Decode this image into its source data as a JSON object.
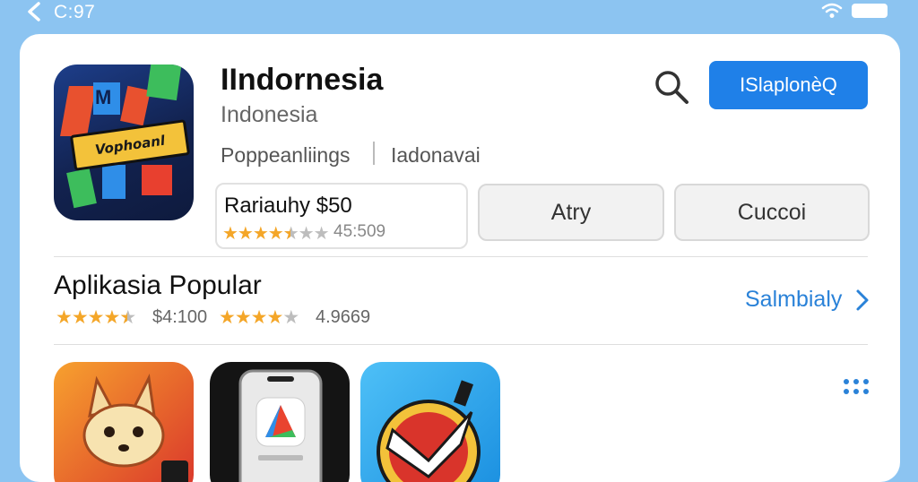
{
  "status_bar": {
    "time": "C:97"
  },
  "app": {
    "name": "IIndornesia",
    "subtitle": "Indonesia",
    "meta_left": "Poppeanliings",
    "meta_right": "Iadonavai",
    "icon_text": "Vophoanl",
    "icon_letters": "M",
    "primary_button": "ISlaplonѐQ",
    "price_label": "Rariauhy $50",
    "price_stars": 3.5,
    "price_rating": "45:509",
    "button_2": "Atry",
    "button_3": "Cuccoi"
  },
  "section": {
    "title": "Aplikasia Popular",
    "rating_1": "$4:100",
    "stars_1": 4.5,
    "rating_2": "4.9669",
    "stars_2": 4,
    "see_all": "Salmbialy"
  },
  "tiles": [
    {
      "name": "fox-app",
      "colors": [
        "#f28a2c",
        "#d9342b"
      ]
    },
    {
      "name": "phone-app",
      "colors": [
        "#1a1a1a",
        "#333333"
      ]
    },
    {
      "name": "check-app",
      "colors": [
        "#36b5f4",
        "#1a8fe0"
      ]
    }
  ],
  "colors": {
    "accent": "#1f80e8",
    "star": "#f4a628",
    "background": "#8cc4f1",
    "link": "#2a82d8"
  }
}
